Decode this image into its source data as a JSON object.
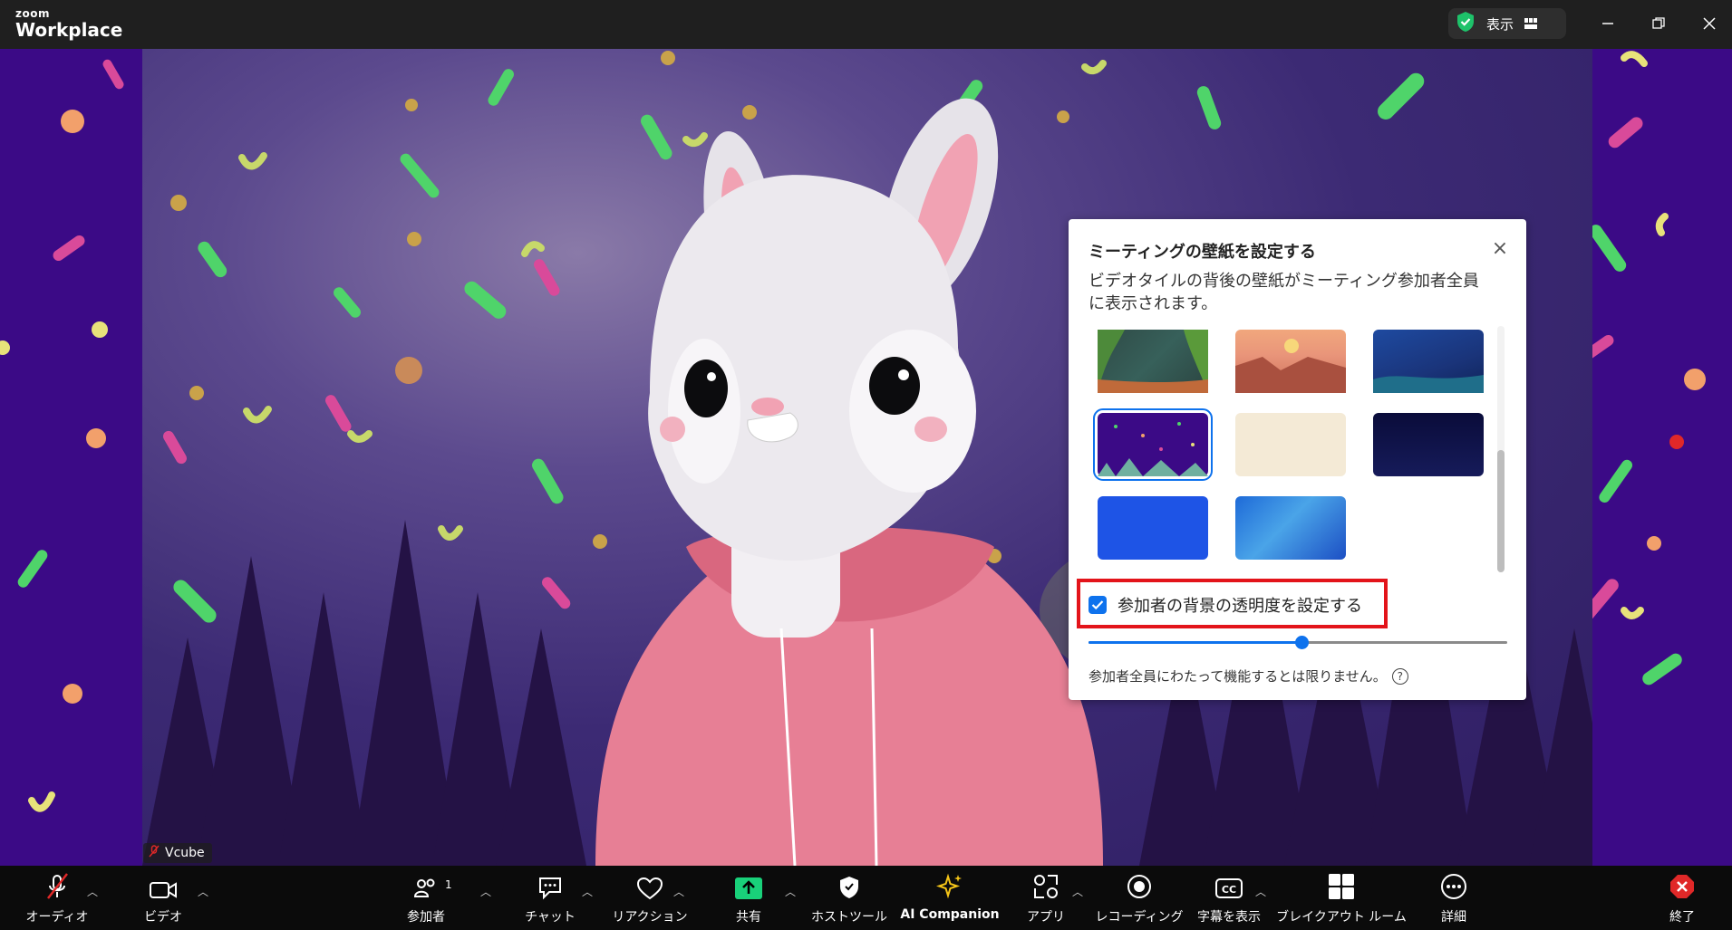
{
  "titlebar": {
    "logo_small": "zoom",
    "logo_big": "Workplace",
    "view_label": "表示"
  },
  "participant": {
    "name": "Vcube"
  },
  "wallpaper_popup": {
    "title": "ミーティングの壁紙を設定する",
    "description": "ビデオタイルの背後の壁紙がミーティング参加者全員に表示されます。",
    "checkbox_label": "参加者の背景の透明度を設定する",
    "checkbox_checked": true,
    "slider_value_fraction": 0.5,
    "note": "参加者全員にわたって機能するとは限りません。",
    "help_glyph": "?",
    "close_glyph": "×",
    "thumbnails": [
      "jungle",
      "desert",
      "underwater",
      "purple-confetti",
      "beige-grid",
      "dark-navy",
      "blue-texture",
      "blue-waves"
    ],
    "selected_thumbnail": "purple-confetti"
  },
  "toolbar": {
    "audio": "オーディオ",
    "video": "ビデオ",
    "participants": "参加者",
    "participants_count": "1",
    "chat": "チャット",
    "reactions": "リアクション",
    "share": "共有",
    "host_tools": "ホストツール",
    "ai_companion": "AI Companion",
    "apps": "アプリ",
    "recording": "レコーディング",
    "captions": "字幕を表示",
    "breakout": "ブレイクアウト ルーム",
    "more": "詳細",
    "end": "終了"
  },
  "colors": {
    "accent": "#0e72ed",
    "highlight_box": "#e3141a",
    "share_green": "#19d17a",
    "end_red": "#e02828",
    "background_purple": "#3b0a86"
  }
}
